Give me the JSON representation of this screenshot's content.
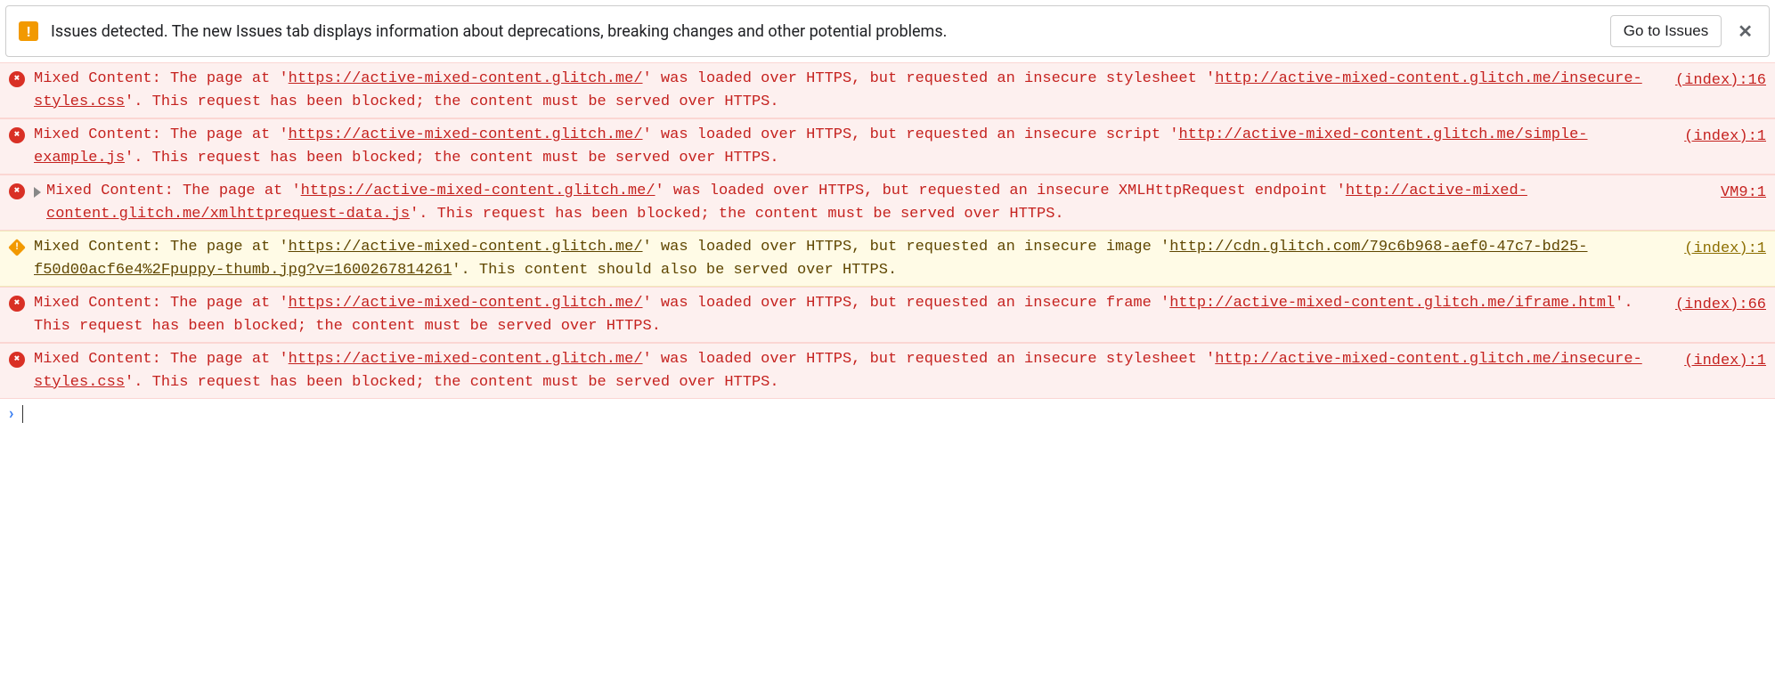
{
  "issuesBar": {
    "text": "Issues detected. The new Issues tab displays information about deprecations, breaking changes and other potential problems.",
    "button": "Go to Issues"
  },
  "rows": [
    {
      "level": "error",
      "expandable": false,
      "pre": "Mixed Content: The page at '",
      "url1": "https://active-mixed-content.glitch.me/",
      "mid": "' was loaded over HTTPS, but requested an insecure stylesheet '",
      "url2": "http://active-mixed-content.glitch.me/insecure-styles.css",
      "post": "'. This request has been blocked; the content must be served over HTTPS.",
      "source": "(index):16"
    },
    {
      "level": "error",
      "expandable": false,
      "pre": "Mixed Content: The page at '",
      "url1": "https://active-mixed-content.glitch.me/",
      "mid": "' was loaded over HTTPS, but requested an insecure script '",
      "url2": "http://active-mixed-content.glitch.me/simple-example.js",
      "post": "'. This request has been blocked; the content must be served over HTTPS.",
      "source": "(index):1"
    },
    {
      "level": "error",
      "expandable": true,
      "pre": "Mixed Content: The page at '",
      "url1": "https://active-mixed-content.glitch.me/",
      "mid": "' was loaded over HTTPS, but requested an insecure XMLHttpRequest endpoint '",
      "url2": "http://active-mixed-content.glitch.me/xmlhttprequest-data.js",
      "post": "'. This request has been blocked; the content must be served over HTTPS.",
      "source": "VM9:1"
    },
    {
      "level": "warning",
      "expandable": false,
      "pre": "Mixed Content: The page at '",
      "url1": "https://active-mixed-content.glitch.me/",
      "mid": "' was loaded over HTTPS, but requested an insecure image '",
      "url2": "http://cdn.glitch.com/79c6b968-aef0-47c7-bd25-f50d00acf6e4%2Fpuppy-thumb.jpg?v=1600267814261",
      "post": "'. This content should also be served over HTTPS.",
      "source": "(index):1"
    },
    {
      "level": "error",
      "expandable": false,
      "pre": "Mixed Content: The page at '",
      "url1": "https://active-mixed-content.glitch.me/",
      "mid": "' was loaded over HTTPS, but requested an insecure frame '",
      "url2": "http://active-mixed-content.glitch.me/iframe.html",
      "post": "'. This request has been blocked; the content must be served over HTTPS.",
      "source": "(index):66"
    },
    {
      "level": "error",
      "expandable": false,
      "pre": "Mixed Content: The page at '",
      "url1": "https://active-mixed-content.glitch.me/",
      "mid": "' was loaded over HTTPS, but requested an insecure stylesheet '",
      "url2": "http://active-mixed-content.glitch.me/insecure-styles.css",
      "post": "'. This request has been blocked; the content must be served over HTTPS.",
      "source": "(index):1"
    }
  ]
}
